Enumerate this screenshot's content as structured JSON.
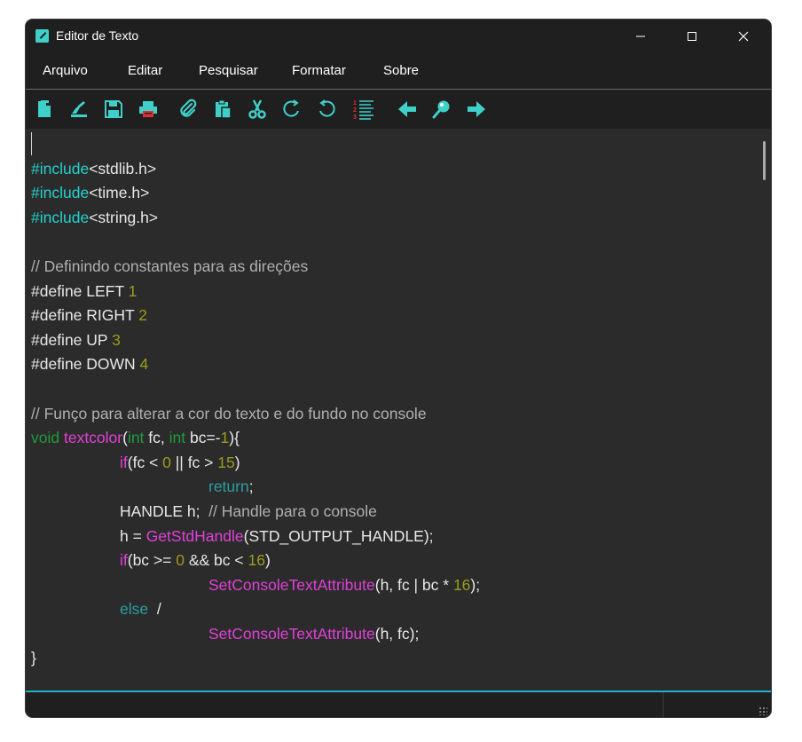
{
  "window": {
    "title": "Editor de Texto",
    "controls": {
      "minimize": "—",
      "maximize": "☐",
      "close": "✕"
    }
  },
  "menu": [
    "Arquivo",
    "Editar",
    "Pesquisar",
    "Formatar",
    "Sobre"
  ],
  "toolbar": {
    "icons": [
      "new-file-icon",
      "open-file-icon",
      "save-icon",
      "print-icon",
      "attach-icon",
      "paste-icon",
      "cut-icon",
      "redo-icon",
      "undo-icon",
      "line-numbers-icon",
      "arrow-left-icon",
      "search-icon",
      "arrow-right-icon"
    ],
    "colors": {
      "accent": "#3fd0c9",
      "print_red": "#e03030"
    }
  },
  "editor": {
    "lines": [
      [],
      [
        {
          "t": "#include",
          "c": "pre"
        },
        {
          "t": "<stdlib.h>",
          "c": "txt"
        }
      ],
      [
        {
          "t": "#include",
          "c": "pre"
        },
        {
          "t": "<time.h>",
          "c": "txt"
        }
      ],
      [
        {
          "t": "#include",
          "c": "pre"
        },
        {
          "t": "<string.h>",
          "c": "txt"
        }
      ],
      [],
      [
        {
          "t": "// Definindo constantes para as direções",
          "c": "comment"
        }
      ],
      [
        {
          "t": "#define LEFT ",
          "c": "txt"
        },
        {
          "t": "1",
          "c": "num"
        }
      ],
      [
        {
          "t": "#define RIGHT ",
          "c": "txt"
        },
        {
          "t": "2",
          "c": "num"
        }
      ],
      [
        {
          "t": "#define UP ",
          "c": "txt"
        },
        {
          "t": "3",
          "c": "num"
        }
      ],
      [
        {
          "t": "#define DOWN ",
          "c": "txt"
        },
        {
          "t": "4",
          "c": "num"
        }
      ],
      [],
      [
        {
          "t": "// Funço para alterar a cor do texto e do fundo no console",
          "c": "comment"
        }
      ],
      [
        {
          "t": "void ",
          "c": "type"
        },
        {
          "t": "textcolor",
          "c": "fn"
        },
        {
          "t": "(",
          "c": "txt"
        },
        {
          "t": "int",
          "c": "type"
        },
        {
          "t": " fc, ",
          "c": "txt"
        },
        {
          "t": "int",
          "c": "type"
        },
        {
          "t": " bc=-",
          "c": "txt"
        },
        {
          "t": "1",
          "c": "num"
        },
        {
          "t": "){",
          "c": "txt"
        }
      ],
      [
        {
          "t": "\t\t",
          "c": "txt"
        },
        {
          "t": "if",
          "c": "kw"
        },
        {
          "t": "(fc < ",
          "c": "txt"
        },
        {
          "t": "0",
          "c": "num"
        },
        {
          "t": " || fc > ",
          "c": "txt"
        },
        {
          "t": "15",
          "c": "num"
        },
        {
          "t": ")",
          "c": "txt"
        }
      ],
      [
        {
          "t": "\t\t\t\t",
          "c": "txt"
        },
        {
          "t": "return",
          "c": "ret"
        },
        {
          "t": ";",
          "c": "txt"
        }
      ],
      [
        {
          "t": "\t\tHANDLE h;  ",
          "c": "txt"
        },
        {
          "t": "// Handle para o console",
          "c": "comment"
        }
      ],
      [
        {
          "t": "\t\th = ",
          "c": "txt"
        },
        {
          "t": "GetStdHandle",
          "c": "fn"
        },
        {
          "t": "(STD_OUTPUT_HANDLE);",
          "c": "txt"
        }
      ],
      [
        {
          "t": "\t\t",
          "c": "txt"
        },
        {
          "t": "if",
          "c": "kw"
        },
        {
          "t": "(bc >= ",
          "c": "txt"
        },
        {
          "t": "0",
          "c": "num"
        },
        {
          "t": " && bc < ",
          "c": "txt"
        },
        {
          "t": "16",
          "c": "num"
        },
        {
          "t": ")",
          "c": "txt"
        }
      ],
      [
        {
          "t": "\t\t\t\t",
          "c": "txt"
        },
        {
          "t": "SetConsoleTextAttribute",
          "c": "fn"
        },
        {
          "t": "(h, fc | bc * ",
          "c": "txt"
        },
        {
          "t": "16",
          "c": "num"
        },
        {
          "t": ");",
          "c": "txt"
        }
      ],
      [
        {
          "t": "\t\t",
          "c": "txt"
        },
        {
          "t": "else",
          "c": "else"
        },
        {
          "t": "  /",
          "c": "txt"
        }
      ],
      [
        {
          "t": "\t\t\t\t",
          "c": "txt"
        },
        {
          "t": "SetConsoleTextAttribute",
          "c": "fn"
        },
        {
          "t": "(h, fc);",
          "c": "txt"
        }
      ],
      [
        {
          "t": "}",
          "c": "txt"
        }
      ]
    ]
  }
}
